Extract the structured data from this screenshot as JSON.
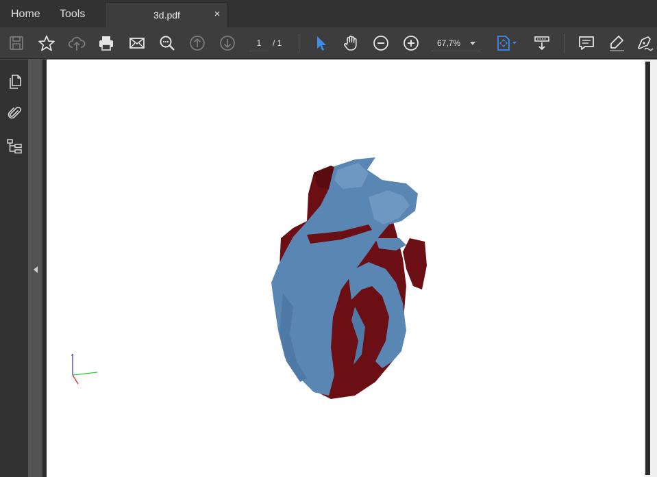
{
  "tabs": {
    "home": "Home",
    "tools": "Tools",
    "document": "3d.pdf",
    "close_glyph": "×"
  },
  "toolbar": {
    "icons": [
      "save-icon",
      "bookmark-star-icon",
      "upload-cloud-icon",
      "print-icon",
      "email-icon",
      "search-zoom-icon",
      "page-up-icon",
      "page-down-icon",
      "select-arrow-icon",
      "hand-tool-icon",
      "zoom-out-icon",
      "zoom-in-icon",
      "fit-page-icon",
      "scrolling-mode-icon",
      "comment-icon",
      "highlight-icon",
      "sign-icon"
    ],
    "page_current": "1",
    "page_total": "/ 1",
    "zoom_value": "67,7%"
  },
  "left_rail": {
    "icons": [
      "pages-thumbnails-icon",
      "attachments-paperclip-icon",
      "structure-tree-icon"
    ]
  },
  "colors": {
    "accent_blue": "#3d8ee8",
    "heart_red": "#6b0f14",
    "heart_blue": "#5a86b4"
  }
}
